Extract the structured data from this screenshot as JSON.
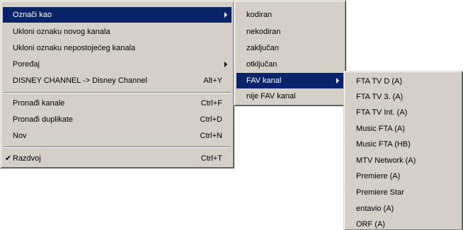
{
  "main_menu": {
    "items": [
      {
        "label": "Označi kao",
        "shortcut": ""
      },
      {
        "label": "Ukloni oznaku novog kanala",
        "shortcut": ""
      },
      {
        "label": "Ukloni oznaku nepostojećeg kanala",
        "shortcut": ""
      },
      {
        "label": "Poređaj",
        "shortcut": ""
      },
      {
        "label": "DISNEY CHANNEL -> Disney Channel",
        "shortcut": "Alt+Y"
      },
      {
        "label": "Pronađi kanale",
        "shortcut": "Ctrl+F"
      },
      {
        "label": "Pronađi duplikate",
        "shortcut": "Ctrl+D"
      },
      {
        "label": "Nov",
        "shortcut": "Ctrl+N"
      },
      {
        "label": "Razdvoj",
        "shortcut": "Ctrl+T",
        "checkmark": "✔"
      }
    ]
  },
  "submenu": {
    "items": [
      {
        "label": "kodiran"
      },
      {
        "label": "nekodiran"
      },
      {
        "label": "zaključan"
      },
      {
        "label": "otključan"
      },
      {
        "label": "FAV kanal"
      },
      {
        "label": "nije FAV kanal"
      }
    ]
  },
  "fav_submenu": {
    "items": [
      {
        "label": "FTA TV D (A)"
      },
      {
        "label": "FTA TV 3. (A)"
      },
      {
        "label": "FTA TV Int. (A)"
      },
      {
        "label": "Music FTA (A)"
      },
      {
        "label": "Music FTA (HB)"
      },
      {
        "label": "MTV Network (A)"
      },
      {
        "label": "Premiere (A)"
      },
      {
        "label": "Premiere Star"
      },
      {
        "label": "entavio (A)"
      },
      {
        "label": "ORF (A)"
      }
    ]
  },
  "colors": {
    "menu_face": "#d4d0c8",
    "highlight": "#0a246a",
    "highlight_text": "#ffffff"
  }
}
